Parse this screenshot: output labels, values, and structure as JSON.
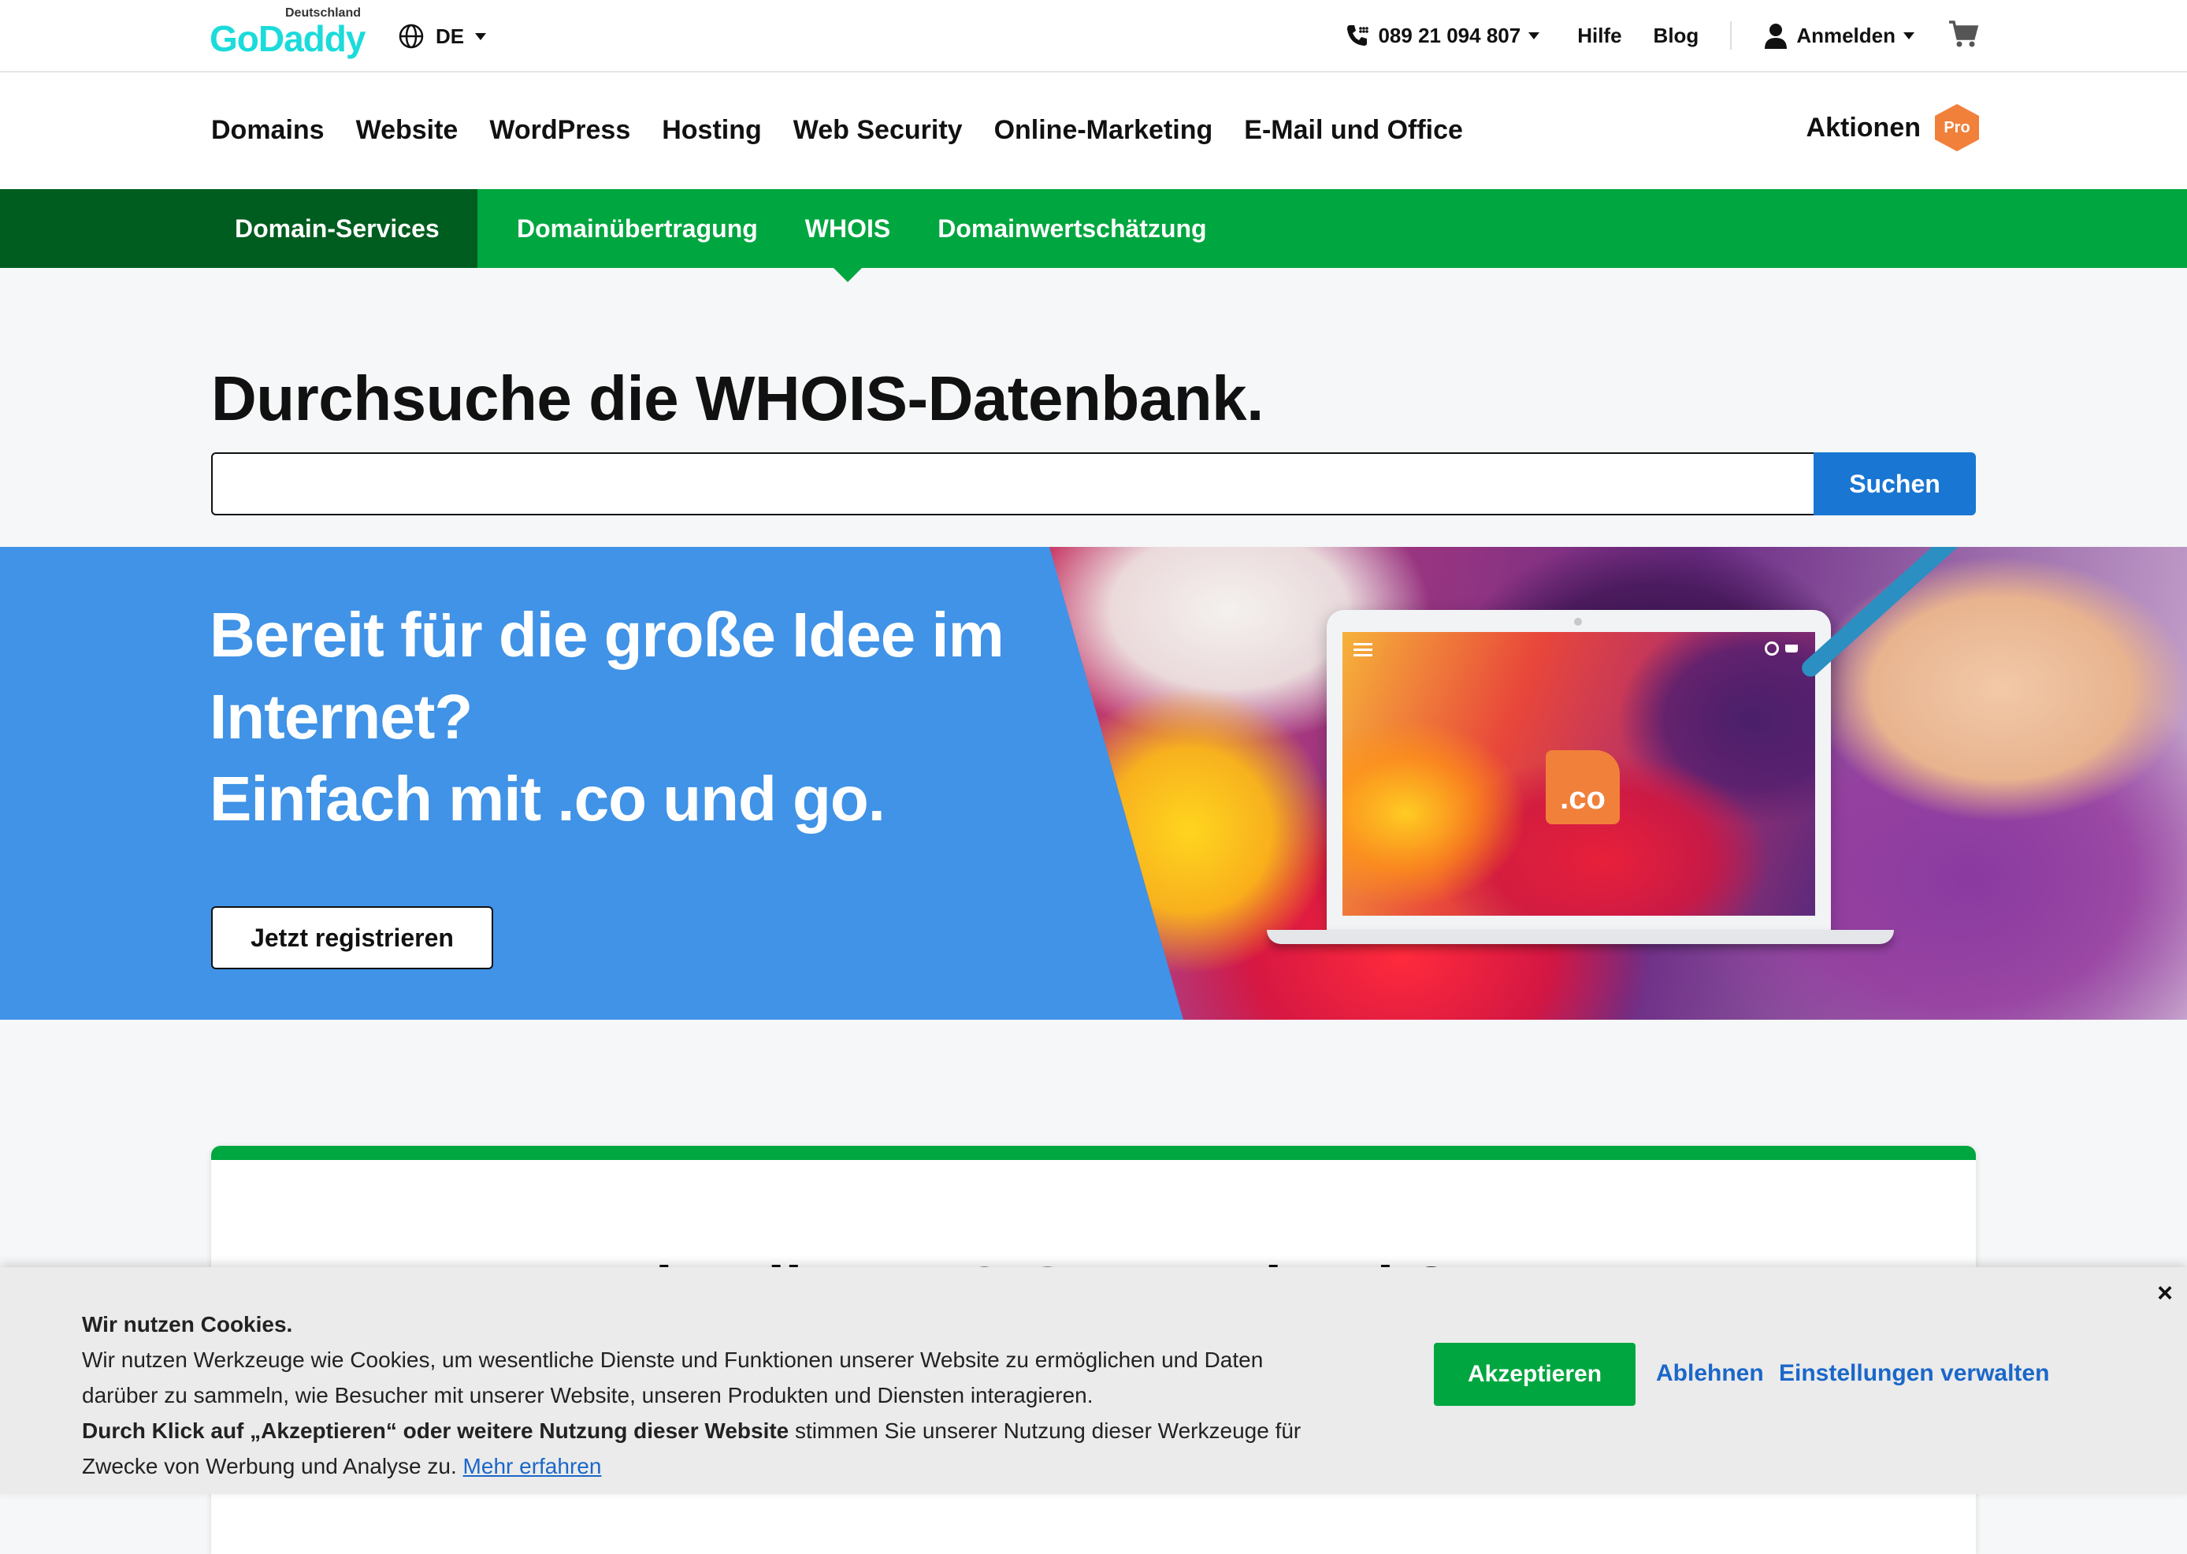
{
  "header": {
    "logo_text": "GoDaddy",
    "logo_country": "Deutschland",
    "language": "DE",
    "phone": "089 21 094 807",
    "help": "Hilfe",
    "blog": "Blog",
    "sign_in": "Anmelden"
  },
  "main_nav": {
    "items": [
      "Domains",
      "Website",
      "WordPress",
      "Hosting",
      "Web Security",
      "Online-Marketing",
      "E-Mail und Office"
    ],
    "promotions": "Aktionen",
    "pro_badge": "Pro"
  },
  "sub_nav": {
    "section": "Domain-Services",
    "links": [
      "Domainübertragung",
      "WHOIS",
      "Domainwertschätzung"
    ],
    "active": "WHOIS"
  },
  "search": {
    "title": "Durchsuche die WHOIS-Datenbank.",
    "input_value": "",
    "button": "Suchen"
  },
  "banner": {
    "headline_line1": "Bereit für die große Idee im Internet?",
    "headline_line2": "Einfach mit .co und go.",
    "cta": "Jetzt registrieren",
    "badge": ".co",
    "background_color": "#4093e6"
  },
  "content_card": {
    "heading": "Was ist die WHOIS-Datenbank?"
  },
  "cookie": {
    "title": "Wir nutzen Cookies.",
    "body": "Wir nutzen Werkzeuge wie Cookies, um wesentliche Dienste und Funktionen unserer Website zu ermöglichen und Daten darüber zu sammeln, wie Besucher mit unserer Website, unseren Produkten und Diensten interagieren.",
    "bold_text": "Durch Klick auf „Akzeptieren“ oder weitere Nutzung dieser Website",
    "body_tail": "stimmen Sie unserer Nutzung dieser Werkzeuge für Zwecke von Werbung und Analyse zu.",
    "learn_more": "Mehr erfahren",
    "accept": "Akzeptieren",
    "reject": "Ablehnen",
    "manage": "Einstellungen verwalten",
    "close": "×"
  },
  "colors": {
    "brand_green": "#00a63f",
    "dark_green": "#005d20",
    "button_blue": "#1976d2",
    "link_blue": "#1a67c9",
    "pro_orange": "#f1803a"
  }
}
